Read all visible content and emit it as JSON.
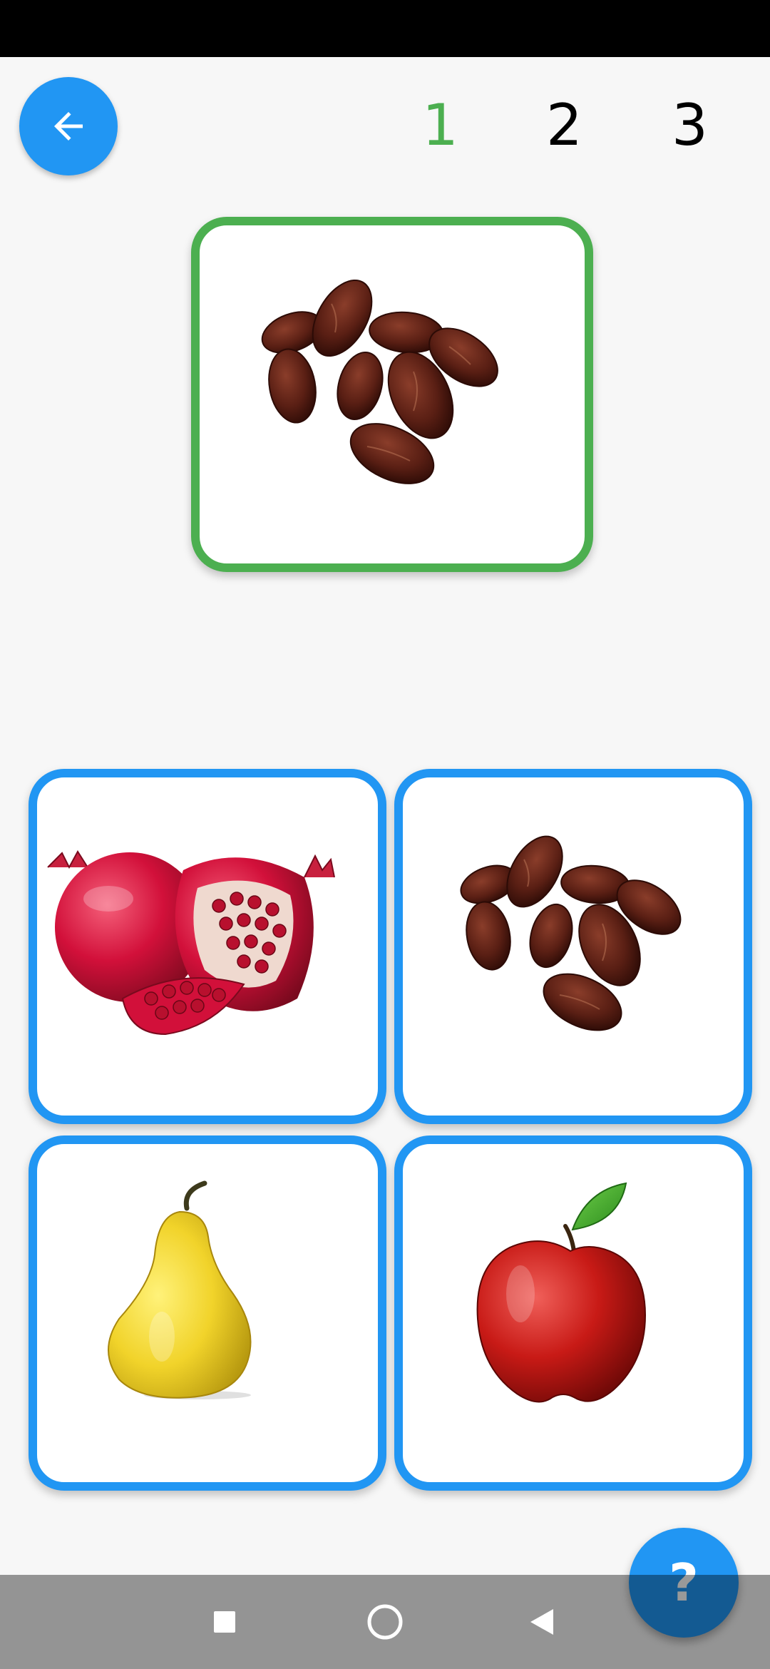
{
  "steps": {
    "items": [
      "1",
      "2",
      "3"
    ],
    "active_color": "#4caf50",
    "inactive_color": "#000000"
  },
  "icons": {
    "back": "arrow-left-icon",
    "help": "question-mark-icon",
    "nav_recents": "square-icon",
    "nav_home": "circle-icon",
    "nav_back": "triangle-back-icon"
  },
  "colors": {
    "accent": "#2196f3",
    "correct": "#4caf50"
  },
  "target": {
    "fruit": "dates"
  },
  "options": [
    {
      "fruit": "pomegranate"
    },
    {
      "fruit": "dates"
    },
    {
      "fruit": "pear"
    },
    {
      "fruit": "apple"
    }
  ],
  "help_label": "?"
}
